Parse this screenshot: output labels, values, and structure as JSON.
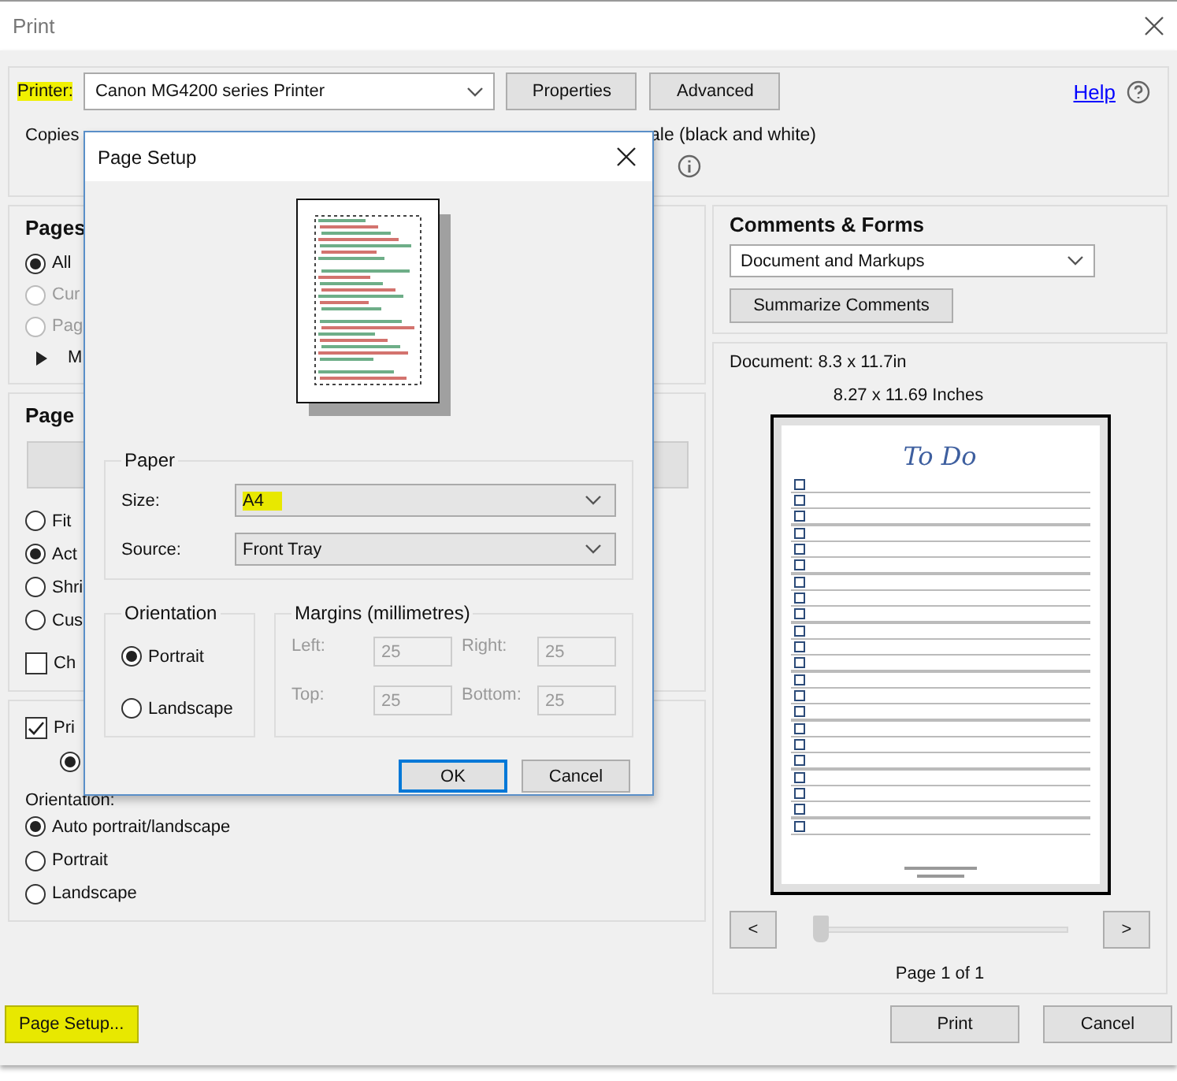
{
  "window": {
    "title": "Print"
  },
  "printer": {
    "label": "Printer:",
    "highlighted": true,
    "value": "Canon MG4200 series Printer"
  },
  "top_buttons": [
    "Properties",
    "Advanced"
  ],
  "help": "Help",
  "copies": {
    "label": "Copies"
  },
  "grayscale_label": "ale (black and white)",
  "pages": {
    "title": "Pages",
    "options": [
      {
        "label": "All",
        "selected": true,
        "disabled": false
      },
      {
        "label": "Cur",
        "selected": false,
        "disabled": true
      },
      {
        "label": "Pag",
        "selected": false,
        "disabled": true
      }
    ],
    "more": {
      "label": "M",
      "expanded": false
    }
  },
  "page_sizing": {
    "title": "Page",
    "options": [
      {
        "label": "Fit",
        "selected": false
      },
      {
        "label": "Act",
        "selected": true
      },
      {
        "label": "Shri",
        "selected": false
      },
      {
        "label": "Cus",
        "selected": false
      }
    ],
    "checkbox": {
      "label": "Ch",
      "checked": false
    }
  },
  "print_on_both": {
    "label": "Pri",
    "checked": true,
    "option": {
      "selected": true
    }
  },
  "orientation": {
    "title": "Orientation:",
    "options": [
      {
        "label": "Auto portrait/landscape",
        "selected": true
      },
      {
        "label": "Portrait",
        "selected": false
      },
      {
        "label": "Landscape",
        "selected": false
      }
    ]
  },
  "page_setup_button": {
    "label": "Page Setup...",
    "highlighted": true
  },
  "comments_forms": {
    "title": "Comments & Forms",
    "value": "Document and Markups",
    "button": "Summarize Comments"
  },
  "preview": {
    "document_size": "Document: 8.3 x 11.7in",
    "page_size": "8.27 x 11.69 Inches",
    "page_title": "To Do",
    "prev": "<",
    "next": ">",
    "slider": {
      "level": 0
    },
    "page_label": "Page 1 of 1"
  },
  "footer_buttons": [
    "Print",
    "Cancel"
  ],
  "page_setup": {
    "title": "Page Setup",
    "paper": {
      "title": "Paper",
      "size_label": "Size:",
      "size": "A4",
      "size_highlighted": true,
      "source_label": "Source:",
      "source": "Front Tray"
    },
    "orientation": {
      "title": "Orientation",
      "options": [
        {
          "label": "Portrait",
          "selected": true
        },
        {
          "label": "Landscape",
          "selected": false
        }
      ]
    },
    "margins": {
      "title": "Margins (millimetres)",
      "disabled": true,
      "fields": [
        {
          "label": "Left:",
          "value": "25"
        },
        {
          "label": "Right:",
          "value": "25"
        },
        {
          "label": "Top:",
          "value": "25"
        },
        {
          "label": "Bottom:",
          "value": "25"
        }
      ]
    },
    "buttons": [
      {
        "label": "OK",
        "default": true
      },
      {
        "label": "Cancel",
        "default": false
      }
    ]
  }
}
